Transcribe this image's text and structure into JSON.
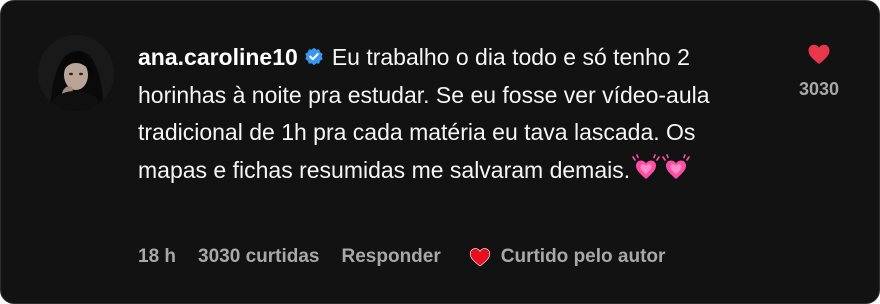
{
  "comment": {
    "username": "ana.caroline10",
    "text": "Eu trabalho o dia todo e só tenho 2 horinhas à noite pra estudar. Se eu fosse ver vídeo-aula tradicional de 1h pra cada matéria eu tava lascada. Os mapas e fichas resumidas me salvaram demais.",
    "emojis": [
      "growing-heart-icon",
      "growing-heart-icon"
    ]
  },
  "like": {
    "count": "3030",
    "heart_color": "#e8374a",
    "liked": true
  },
  "meta": {
    "time": "18 h",
    "likes": "3030 curtidas",
    "reply": "Responder",
    "author_liked": "Curtido pelo autor"
  },
  "colors": {
    "background": "#121212",
    "border": "#2e2e2e",
    "text": "#f5f5f5",
    "muted": "#a8a8a8",
    "verified": "#3897f0",
    "emoji_pink": "#ff4fa3"
  }
}
